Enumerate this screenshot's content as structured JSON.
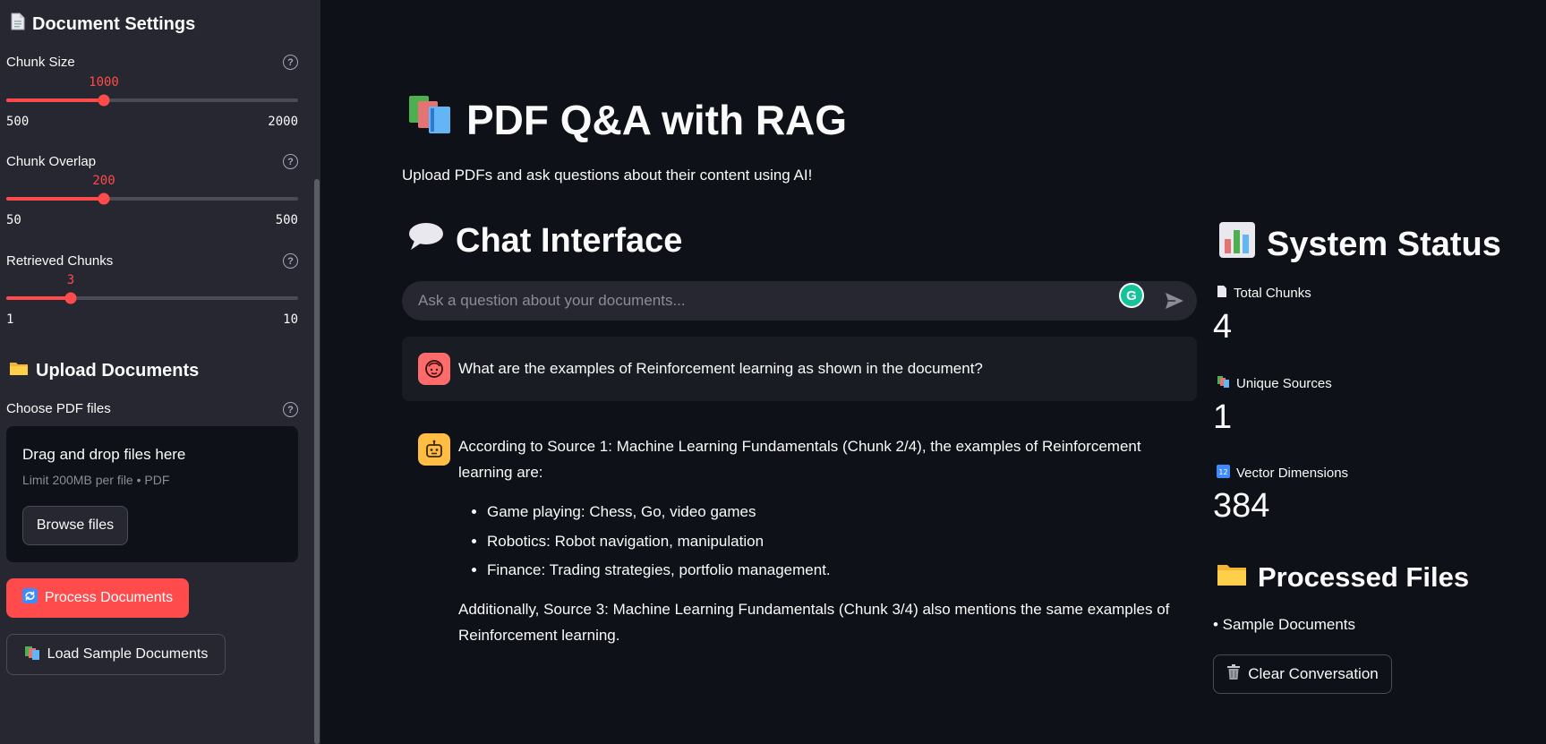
{
  "sidebar": {
    "doc_settings_title": "Document Settings",
    "sliders": [
      {
        "label": "Chunk Size",
        "value": "1000",
        "min": "500",
        "max": "2000",
        "fraction": 0.333
      },
      {
        "label": "Chunk Overlap",
        "value": "200",
        "min": "50",
        "max": "500",
        "fraction": 0.333
      },
      {
        "label": "Retrieved Chunks",
        "value": "3",
        "min": "1",
        "max": "10",
        "fraction": 0.222
      }
    ],
    "upload_title": "Upload Documents",
    "choose_label": "Choose PDF files",
    "dropzone": {
      "title": "Drag and drop files here",
      "limit": "Limit 200MB per file • PDF",
      "browse_label": "Browse files"
    },
    "process_label": "Process Documents",
    "load_sample_label": "Load Sample Documents"
  },
  "main": {
    "title": "PDF Q&A with RAG",
    "subtitle": "Upload PDFs and ask questions about their content using AI!",
    "chat_title": "Chat Interface",
    "chat_placeholder": "Ask a question about your documents...",
    "user_message": "What are the examples of Reinforcement learning as shown in the document?",
    "bot_intro": "According to Source 1: Machine Learning Fundamentals (Chunk 2/4), the examples of Reinforcement learning are:",
    "bot_bullets": [
      "Game playing: Chess, Go, video games",
      "Robotics: Robot navigation, manipulation",
      "Finance: Trading strategies, portfolio management."
    ],
    "bot_outro": "Additionally, Source 3: Machine Learning Fundamentals (Chunk 3/4) also mentions the same examples of Reinforcement learning."
  },
  "status": {
    "title": "System Status",
    "total_chunks_label": "Total Chunks",
    "total_chunks": "4",
    "unique_sources_label": "Unique Sources",
    "unique_sources": "1",
    "vector_dims_label": "Vector Dimensions",
    "vector_dims": "384",
    "processed_title": "Processed Files",
    "processed_files": [
      "• Sample Documents"
    ],
    "clear_label": "Clear Conversation"
  },
  "colors": {
    "accent": "#ff4b4b",
    "background": "#0e1117",
    "sidebar": "#262730"
  }
}
